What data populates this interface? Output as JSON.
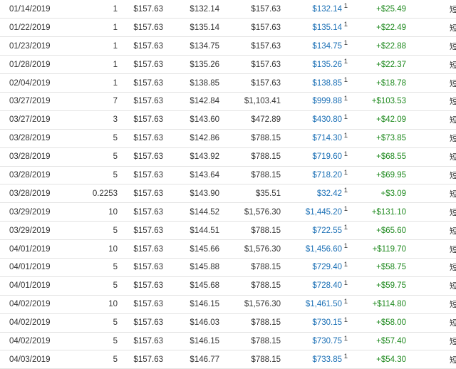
{
  "lots": {
    "rows": [
      {
        "date": "01/14/2019",
        "quantity": "1",
        "price": "$157.63",
        "cost_per_share": "$132.14",
        "total": "$157.63",
        "value": "$132.14",
        "note": "1",
        "gain": "+$25.49",
        "term": "短期"
      },
      {
        "date": "01/22/2019",
        "quantity": "1",
        "price": "$157.63",
        "cost_per_share": "$135.14",
        "total": "$157.63",
        "value": "$135.14",
        "note": "1",
        "gain": "+$22.49",
        "term": "短期"
      },
      {
        "date": "01/23/2019",
        "quantity": "1",
        "price": "$157.63",
        "cost_per_share": "$134.75",
        "total": "$157.63",
        "value": "$134.75",
        "note": "1",
        "gain": "+$22.88",
        "term": "短期"
      },
      {
        "date": "01/28/2019",
        "quantity": "1",
        "price": "$157.63",
        "cost_per_share": "$135.26",
        "total": "$157.63",
        "value": "$135.26",
        "note": "1",
        "gain": "+$22.37",
        "term": "短期"
      },
      {
        "date": "02/04/2019",
        "quantity": "1",
        "price": "$157.63",
        "cost_per_share": "$138.85",
        "total": "$157.63",
        "value": "$138.85",
        "note": "1",
        "gain": "+$18.78",
        "term": "短期"
      },
      {
        "date": "03/27/2019",
        "quantity": "7",
        "price": "$157.63",
        "cost_per_share": "$142.84",
        "total": "$1,103.41",
        "value": "$999.88",
        "note": "1",
        "gain": "+$103.53",
        "term": "短期"
      },
      {
        "date": "03/27/2019",
        "quantity": "3",
        "price": "$157.63",
        "cost_per_share": "$143.60",
        "total": "$472.89",
        "value": "$430.80",
        "note": "1",
        "gain": "+$42.09",
        "term": "短期"
      },
      {
        "date": "03/28/2019",
        "quantity": "5",
        "price": "$157.63",
        "cost_per_share": "$142.86",
        "total": "$788.15",
        "value": "$714.30",
        "note": "1",
        "gain": "+$73.85",
        "term": "短期"
      },
      {
        "date": "03/28/2019",
        "quantity": "5",
        "price": "$157.63",
        "cost_per_share": "$143.92",
        "total": "$788.15",
        "value": "$719.60",
        "note": "1",
        "gain": "+$68.55",
        "term": "短期"
      },
      {
        "date": "03/28/2019",
        "quantity": "5",
        "price": "$157.63",
        "cost_per_share": "$143.64",
        "total": "$788.15",
        "value": "$718.20",
        "note": "1",
        "gain": "+$69.95",
        "term": "短期"
      },
      {
        "date": "03/28/2019",
        "quantity": "0.2253",
        "price": "$157.63",
        "cost_per_share": "$143.90",
        "total": "$35.51",
        "value": "$32.42",
        "note": "1",
        "gain": "+$3.09",
        "term": "短期"
      },
      {
        "date": "03/29/2019",
        "quantity": "10",
        "price": "$157.63",
        "cost_per_share": "$144.52",
        "total": "$1,576.30",
        "value": "$1,445.20",
        "note": "1",
        "gain": "+$131.10",
        "term": "短期"
      },
      {
        "date": "03/29/2019",
        "quantity": "5",
        "price": "$157.63",
        "cost_per_share": "$144.51",
        "total": "$788.15",
        "value": "$722.55",
        "note": "1",
        "gain": "+$65.60",
        "term": "短期"
      },
      {
        "date": "04/01/2019",
        "quantity": "10",
        "price": "$157.63",
        "cost_per_share": "$145.66",
        "total": "$1,576.30",
        "value": "$1,456.60",
        "note": "1",
        "gain": "+$119.70",
        "term": "短期"
      },
      {
        "date": "04/01/2019",
        "quantity": "5",
        "price": "$157.63",
        "cost_per_share": "$145.88",
        "total": "$788.15",
        "value": "$729.40",
        "note": "1",
        "gain": "+$58.75",
        "term": "短期"
      },
      {
        "date": "04/01/2019",
        "quantity": "5",
        "price": "$157.63",
        "cost_per_share": "$145.68",
        "total": "$788.15",
        "value": "$728.40",
        "note": "1",
        "gain": "+$59.75",
        "term": "短期"
      },
      {
        "date": "04/02/2019",
        "quantity": "10",
        "price": "$157.63",
        "cost_per_share": "$146.15",
        "total": "$1,576.30",
        "value": "$1,461.50",
        "note": "1",
        "gain": "+$114.80",
        "term": "短期"
      },
      {
        "date": "04/02/2019",
        "quantity": "5",
        "price": "$157.63",
        "cost_per_share": "$146.03",
        "total": "$788.15",
        "value": "$730.15",
        "note": "1",
        "gain": "+$58.00",
        "term": "短期"
      },
      {
        "date": "04/02/2019",
        "quantity": "5",
        "price": "$157.63",
        "cost_per_share": "$146.15",
        "total": "$788.15",
        "value": "$730.75",
        "note": "1",
        "gain": "+$57.40",
        "term": "短期"
      },
      {
        "date": "04/03/2019",
        "quantity": "5",
        "price": "$157.63",
        "cost_per_share": "$146.77",
        "total": "$788.15",
        "value": "$733.85",
        "note": "1",
        "gain": "+$54.30",
        "term": "短期"
      }
    ]
  },
  "colors": {
    "value_link": "#1a6fb5",
    "gain_positive": "#1f8a1f",
    "row_divider": "#e3e3e3"
  }
}
